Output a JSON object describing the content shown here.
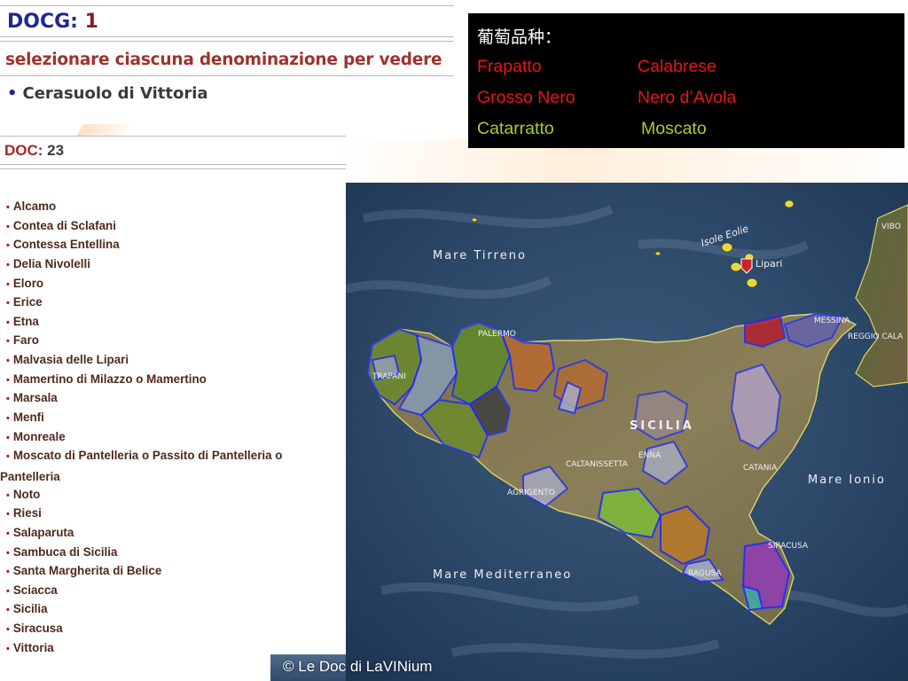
{
  "docg": {
    "label": "DOCG:",
    "count": "1",
    "instruction": "selezionare ciascuna denominazione per vedere",
    "bullet": "•",
    "items": [
      "Cerasuolo di Vittoria"
    ]
  },
  "doc": {
    "label": "DOC",
    "count": ": 23",
    "bullet": "•",
    "items": [
      "Alcamo",
      "Contea di Sclafani",
      "Contessa Entellina",
      "Delia Nivolelli",
      "Eloro",
      "Erice",
      "Etna",
      "Faro",
      "Malvasia delle Lipari",
      "Mamertino di Milazzo o Mamertino",
      "Marsala",
      "Menfi",
      "Monreale",
      "Moscato di Pantelleria o Passito di Pantelleria o",
      "Pantelleria",
      "Noto",
      "Riesi",
      "Salaparuta",
      "Sambuca di Sicilia",
      "Santa Margherita di Belice",
      "Sciacca",
      "Sicilia",
      "Siracusa",
      "Vittoria"
    ]
  },
  "grapes": {
    "header": "葡萄品种：",
    "red": [
      "Frapatto",
      "Calabrese",
      "Grosso Nero",
      "Nero d’Avola"
    ],
    "white": [
      "Catarratto",
      "Moscato"
    ],
    "colors": {
      "red": "#e8141b",
      "white": "#a6cf2a",
      "header": "#ffffff",
      "background": "#000000"
    }
  },
  "map": {
    "labels": {
      "mare_tirreno": "Mare Tirreno",
      "isole_eolie": "Isole Eolie",
      "lipari": "Lipari",
      "vibo": "VIBO",
      "messina": "MESSINA",
      "reggio": "REGGIO CALA",
      "palermo": "PALERMO",
      "trapani": "TRAPANI",
      "sicilia": "SICILIA",
      "enna": "ENNA",
      "caltanissetta": "CALTANISSETTA",
      "catania": "CATANIA",
      "mare_ionio": "Mare Ionio",
      "agrigento": "AGRIGENTO",
      "mare_mediterraneo": "Mare Mediterraneo",
      "ragusa": "RAGUSA",
      "siracusa": "SIRACUSA"
    },
    "colors": {
      "sea": "#2b4766",
      "land": "#7f7550",
      "boundary": "#1e2bff",
      "coast": "#d9d36a"
    }
  },
  "copyright": "© Le Doc di LaVINium"
}
